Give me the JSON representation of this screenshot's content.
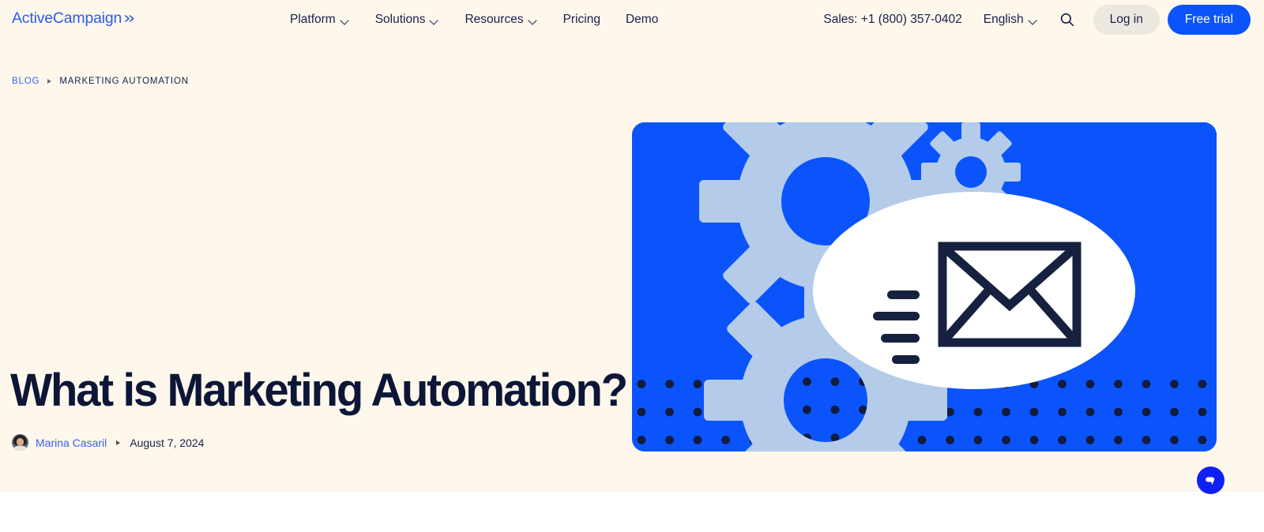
{
  "header": {
    "logo_text": "ActiveCampaign",
    "logo_chevron": "»",
    "nav_items": [
      {
        "label": "Platform",
        "has_dropdown": true
      },
      {
        "label": "Solutions",
        "has_dropdown": true
      },
      {
        "label": "Resources",
        "has_dropdown": true
      },
      {
        "label": "Pricing",
        "has_dropdown": false
      },
      {
        "label": "Demo",
        "has_dropdown": false
      }
    ],
    "sales_phone": "Sales: +1 (800) 357-0402",
    "language": "English",
    "search_icon": "search-icon",
    "login_label": "Log in",
    "trial_label": "Free trial"
  },
  "breadcrumb": {
    "root_label": "BLOG",
    "separator": "▸",
    "current_label": "MARKETING AUTOMATION"
  },
  "article": {
    "title": "What is Marketing Automation?",
    "author": "Marina Casaril",
    "separator": "▸",
    "date": "August 7, 2024",
    "avatar_alt": "author-avatar"
  },
  "hero": {
    "alt": "marketing automation illustration with gears and envelope"
  },
  "chat": {
    "label": "chat-bubble-icon"
  },
  "colors": {
    "page_background": "#FDF7EC",
    "below_fold_background": "#FFFFFF",
    "brand_blue": "#0B54FB",
    "logo_blue": "#2B5CE6",
    "link_blue": "#3B63E8",
    "navy_text": "#1A1F4D",
    "title_navy": "#0E1637",
    "login_pill": "#EDE8DF",
    "hero_blue": "#0B54FB",
    "hero_gear": "#B4CCEA",
    "hero_white": "#FFFFFF",
    "hero_dot_navy": "#111C3F",
    "chat_blue": "#1020F5"
  }
}
